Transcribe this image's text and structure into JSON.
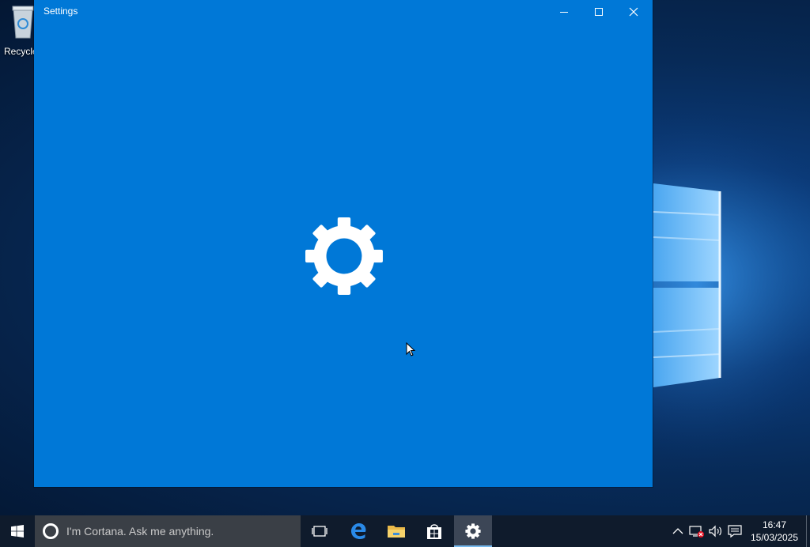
{
  "desktop": {
    "icons": [
      {
        "label": "Recycle",
        "icon": "recycle-bin-icon"
      }
    ]
  },
  "window": {
    "title": "Settings",
    "background": "#0078d7",
    "splash_icon": "gear-icon",
    "controls": [
      "minimize-icon",
      "maximize-icon",
      "close-icon"
    ]
  },
  "taskbar": {
    "search_placeholder": "I'm Cortana. Ask me anything.",
    "pinned": [
      {
        "name": "task-view",
        "icon": "task-view-icon"
      },
      {
        "name": "edge",
        "icon": "edge-icon"
      },
      {
        "name": "file-explorer",
        "icon": "folder-icon"
      },
      {
        "name": "store",
        "icon": "store-icon"
      },
      {
        "name": "settings",
        "icon": "gear-icon",
        "active": true
      }
    ],
    "tray": {
      "icons": [
        "chevron-up-icon",
        "network-disconnected-icon",
        "volume-icon",
        "notifications-icon"
      ],
      "time": "16:47",
      "date": "15/03/2025"
    }
  },
  "colors": {
    "accent": "#0078d7",
    "taskbar": "#0f1b2c",
    "active_underline": "#76b9ed"
  }
}
